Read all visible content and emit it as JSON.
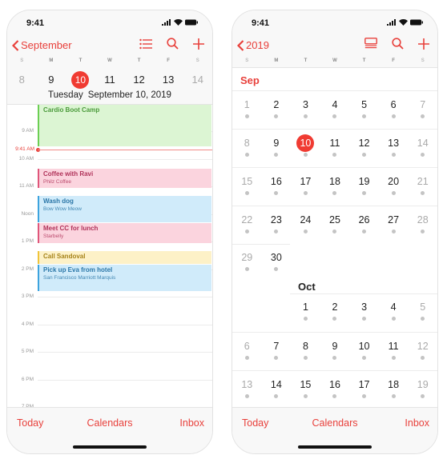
{
  "status_bar": {
    "time": "9:41"
  },
  "colors": {
    "accent": "#e8403b",
    "today_circle": "#f03b32"
  },
  "day_view": {
    "back_label": "September",
    "nav_icons": [
      "list-icon",
      "search-icon",
      "add-icon"
    ],
    "week_letters": [
      "S",
      "M",
      "T",
      "W",
      "T",
      "F",
      "S"
    ],
    "week_days": [
      "8",
      "9",
      "10",
      "11",
      "12",
      "13",
      "14"
    ],
    "today_index": 2,
    "selected_weekday": "Tuesday",
    "selected_date": "September 10, 2019",
    "hours": [
      "9 AM",
      "10 AM",
      "11 AM",
      "Noon",
      "1 PM",
      "2 PM",
      "3 PM",
      "4 PM",
      "5 PM",
      "6 PM",
      "7 PM"
    ],
    "now_label": "9:41 AM",
    "events": [
      {
        "title": "Cardio Boot Camp",
        "subtitle": "",
        "color": "green"
      },
      {
        "title": "Coffee with Ravi",
        "subtitle": "Philz Coffee",
        "color": "pink"
      },
      {
        "title": "Wash dog",
        "subtitle": "Bow Wow Meow",
        "color": "blue"
      },
      {
        "title": "Meet CC for lunch",
        "subtitle": "Starbelly",
        "color": "pink"
      },
      {
        "title": "Call Sandoval",
        "subtitle": "",
        "color": "yellow"
      },
      {
        "title": "Pick up Eva from hotel",
        "subtitle": "San Francisco Marriott Marquis",
        "color": "blue"
      }
    ]
  },
  "month_view": {
    "back_label": "2019",
    "nav_icons": [
      "day-list-icon",
      "search-icon",
      "add-icon"
    ],
    "week_letters": [
      "S",
      "M",
      "T",
      "W",
      "T",
      "F",
      "S"
    ],
    "months": [
      {
        "label": "Sep",
        "rows": [
          [
            "1",
            "2",
            "3",
            "4",
            "5",
            "6",
            "7"
          ],
          [
            "8",
            "9",
            "10",
            "11",
            "12",
            "13",
            "14"
          ],
          [
            "15",
            "16",
            "17",
            "18",
            "19",
            "20",
            "21"
          ],
          [
            "22",
            "23",
            "24",
            "25",
            "26",
            "27",
            "28"
          ],
          [
            "29",
            "30",
            "",
            "",
            "",
            "",
            ""
          ]
        ],
        "today": "10"
      },
      {
        "label": "Oct",
        "rows": [
          [
            "",
            "",
            "1",
            "2",
            "3",
            "4",
            "5"
          ],
          [
            "6",
            "7",
            "8",
            "9",
            "10",
            "11",
            "12"
          ],
          [
            "13",
            "14",
            "15",
            "16",
            "17",
            "18",
            "19"
          ]
        ]
      }
    ]
  },
  "tab_bar": {
    "today": "Today",
    "calendars": "Calendars",
    "inbox": "Inbox"
  }
}
